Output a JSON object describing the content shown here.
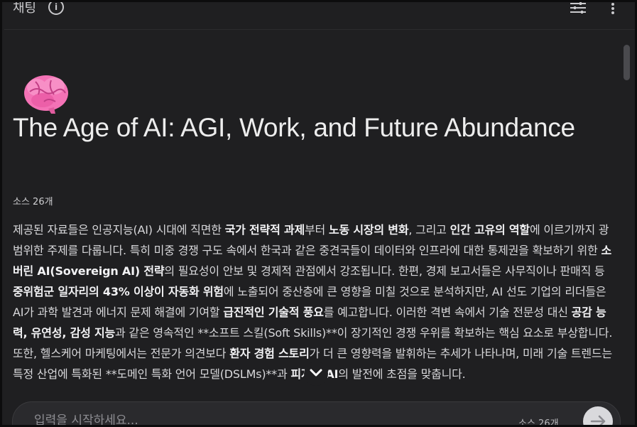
{
  "header": {
    "title": "채팅",
    "info_icon": "info-icon",
    "tune_icon": "tune-icon",
    "more_icon": "more-vert-icon"
  },
  "notebook": {
    "emoji": "brain-emoji",
    "title": "The Age of AI: AGI, Work, and Future Abundance",
    "source_count": "소스 26개",
    "summary": [
      {
        "t": "제공된 자료들은 인공지능(AI) 시대에 직면한 ",
        "b": false
      },
      {
        "t": "국가 전략적 과제",
        "b": true
      },
      {
        "t": "부터 ",
        "b": false
      },
      {
        "t": "노동 시장의 변화",
        "b": true
      },
      {
        "t": ", 그리고 ",
        "b": false
      },
      {
        "t": "인간 고유의 역할",
        "b": true
      },
      {
        "t": "에 이르기까지 광범위한 주제를 다룹니다. 특히 미중 경쟁 구도 속에서 한국과 같은 중견국들이 데이터와 인프라에 대한 통제권을 확보하기 위한 ",
        "b": false
      },
      {
        "t": "소버린 AI(Sovereign AI) 전략",
        "b": true
      },
      {
        "t": "의 필요성이 안보 및 경제적 관점에서 강조됩니다. 한편, 경제 보고서들은 사무직이나 판매직 등 ",
        "b": false
      },
      {
        "t": "중위험군 일자리의 43% 이상이 자동화 위험",
        "b": true
      },
      {
        "t": "에 노출되어 중산층에 큰 영향을 미칠 것으로 분석하지만, AI 선도 기업의 리더들은 AI가 과학 발견과 에너지 문제 해결에 기여할 ",
        "b": false
      },
      {
        "t": "급진적인 기술적 풍요",
        "b": true
      },
      {
        "t": "를 예고합니다. 이러한 격변 속에서 기술 전문성 대신 ",
        "b": false
      },
      {
        "t": "공감 능력, 유연성, 감성 지능",
        "b": true
      },
      {
        "t": "과 같은 영속적인 **소프트 스킬(Soft Skills)**이 장기적인 경쟁 우위를 확보하는 핵심 요소로 부상합니다. 또한, 헬스케어 마케팅에서는 전문가 의견보다 ",
        "b": false
      },
      {
        "t": "환자 경험 스토리",
        "b": true
      },
      {
        "t": "가 더 큰 영향력을 발휘하는 추세가 나타나며, 미래 기술 트렌드는 특정 산업에 특화된 **도메인 특화 언어 모델(DSLMs)**과 ",
        "b": false
      },
      {
        "t": "피지컬 AI",
        "b": true
      },
      {
        "t": "의 발전에 초점을 맞춥니다.",
        "b": false
      }
    ]
  },
  "scroll_down_icon": "chevron-down-icon",
  "composer": {
    "placeholder": "입력을 시작하세요...",
    "source_count": "소스 26개",
    "send_icon": "arrow-right-icon"
  },
  "colors": {
    "background": "#1f1f21",
    "text": "#d8d8db",
    "emoji_pink": "#f472b6"
  }
}
